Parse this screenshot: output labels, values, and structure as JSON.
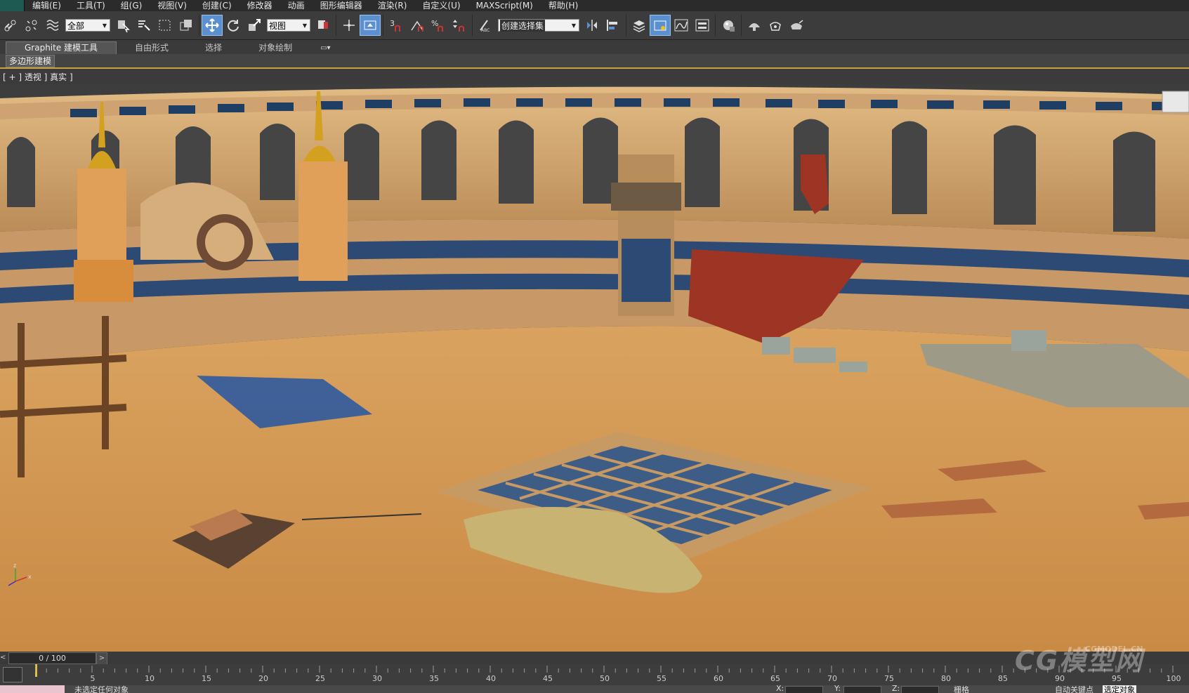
{
  "menubar": {
    "items": [
      "编辑(E)",
      "工具(T)",
      "组(G)",
      "视图(V)",
      "创建(C)",
      "修改器",
      "动画",
      "图形编辑器",
      "渲染(R)",
      "自定义(U)",
      "MAXScript(M)",
      "帮助(H)"
    ]
  },
  "toolbar": {
    "selection_filter": "全部",
    "reference_coord": "视图",
    "named_selection_set": "创建选择集"
  },
  "ribbon": {
    "tabs": [
      "Graphite 建模工具",
      "自由形式",
      "选择",
      "对象绘制"
    ],
    "panel_tab": "多边形建模"
  },
  "viewport": {
    "label": "[ + ] 透视 ] 真实 ]"
  },
  "timeline": {
    "frame_counter": "0 / 100",
    "prev_label": "<",
    "next_label": ">",
    "ticks": [
      "5",
      "10",
      "15",
      "20",
      "25",
      "30",
      "35",
      "40",
      "45",
      "50",
      "55",
      "60",
      "65",
      "70",
      "75",
      "80",
      "85",
      "90",
      "95",
      "100"
    ]
  },
  "status": {
    "text": "未选定任何对象",
    "x_label": "X:",
    "y_label": "Y:",
    "z_label": "Z:",
    "grid_label": "栅格",
    "autokey_label": "自动关键点",
    "selected_object": "选定对象"
  },
  "watermark": {
    "logo": "CG模型网",
    "url": "CGMODEL.CN"
  },
  "colors": {
    "accent": "#5a8fd0",
    "ribbon_underline": "#c9a23a",
    "status_swatch": "#e9c6cf"
  }
}
